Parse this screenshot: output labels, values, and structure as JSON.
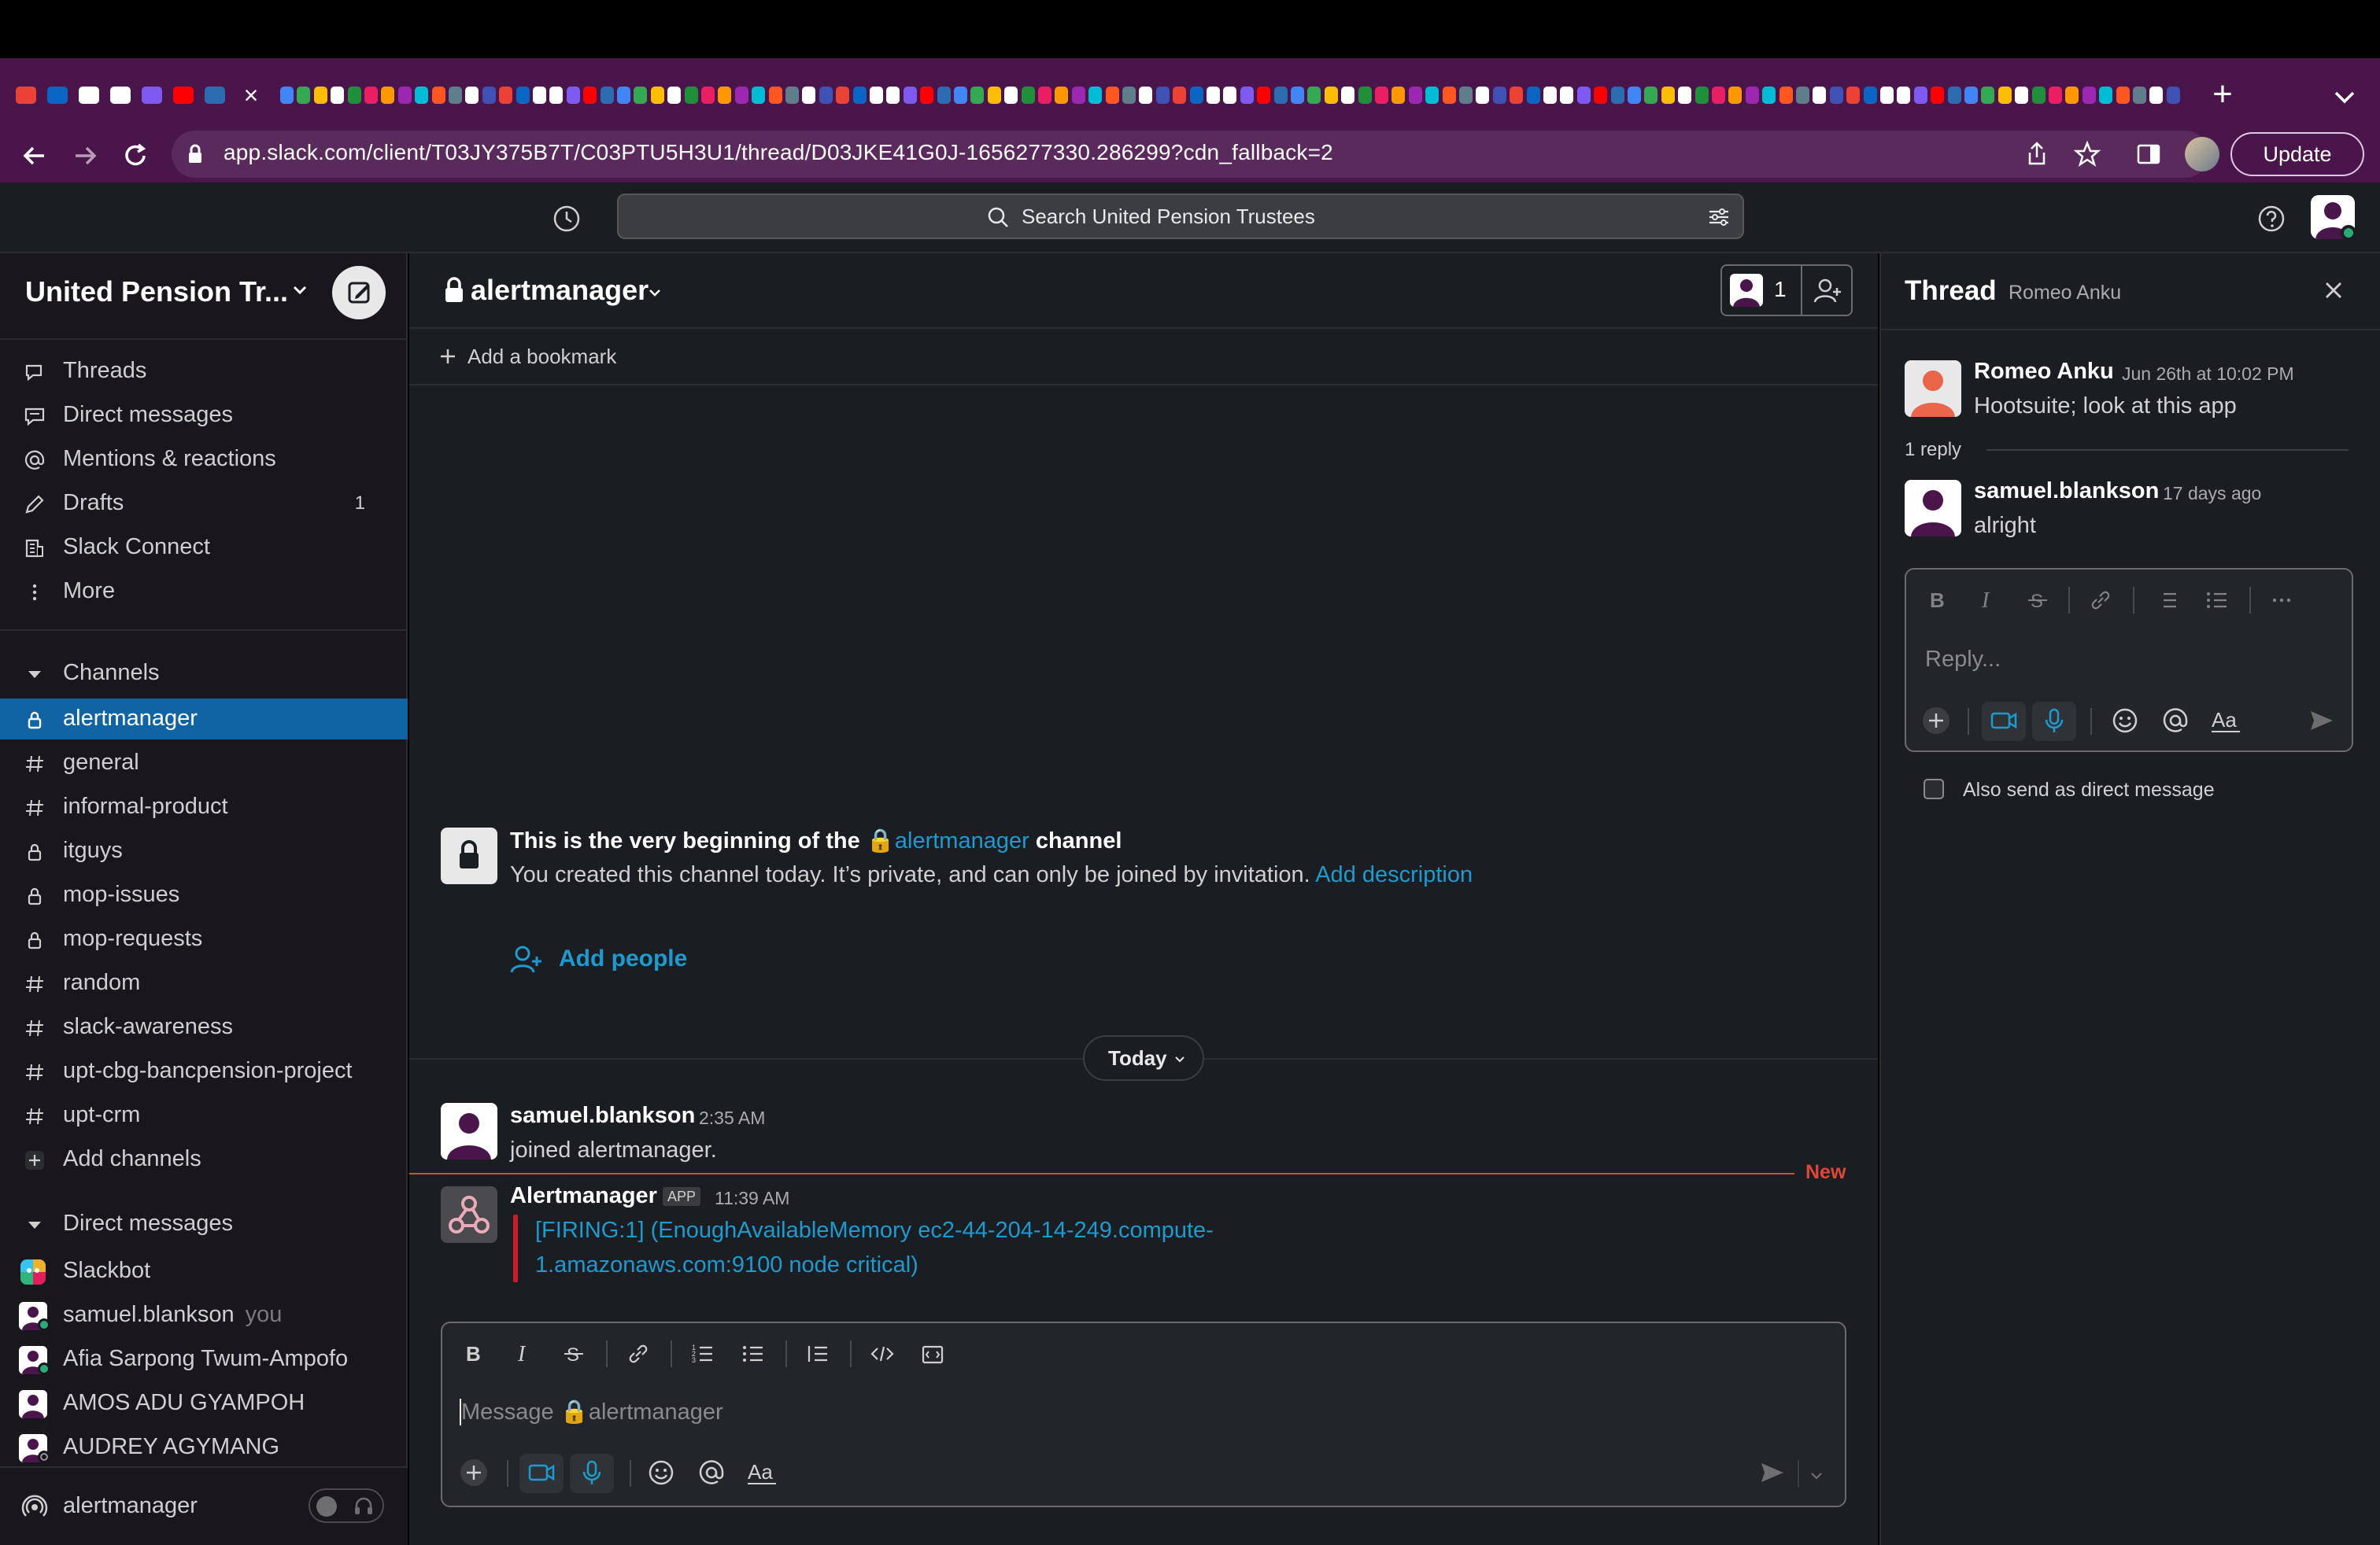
{
  "browser": {
    "url": "app.slack.com/client/T03JY375B7T/C03PTU5H3U1/thread/D03JKE41G0J-1656277330.286299?cdn_fallback=2",
    "update_label": "Update"
  },
  "topbar": {
    "search_placeholder": "Search United Pension Trustees"
  },
  "sidebar": {
    "workspace": "United Pension Tr...",
    "nav": [
      {
        "label": "Threads",
        "icon": "threads-icon"
      },
      {
        "label": "Direct messages",
        "icon": "direct-messages-icon"
      },
      {
        "label": "Mentions & reactions",
        "icon": "mentions-icon"
      },
      {
        "label": "Drafts",
        "icon": "drafts-icon",
        "count": "1"
      },
      {
        "label": "Slack Connect",
        "icon": "slack-connect-icon"
      },
      {
        "label": "More",
        "icon": "more-icon"
      }
    ],
    "channels_header": "Channels",
    "channels": [
      {
        "label": "alertmanager",
        "private": true,
        "active": true
      },
      {
        "label": "general",
        "private": false
      },
      {
        "label": "informal-product",
        "private": false
      },
      {
        "label": "itguys",
        "private": true
      },
      {
        "label": "mop-issues",
        "private": true
      },
      {
        "label": "mop-requests",
        "private": true
      },
      {
        "label": "random",
        "private": false
      },
      {
        "label": "slack-awareness",
        "private": false
      },
      {
        "label": "upt-cbg-bancpension-project",
        "private": false
      },
      {
        "label": "upt-crm",
        "private": false
      }
    ],
    "add_channels": "Add channels",
    "dm_header": "Direct messages",
    "dms": [
      {
        "label": "Slackbot",
        "suffix": ""
      },
      {
        "label": "samuel.blankson",
        "suffix": "you"
      },
      {
        "label": "Afia Sarpong Twum-Ampofo",
        "suffix": ""
      },
      {
        "label": "AMOS ADU GYAMPOH",
        "suffix": ""
      },
      {
        "label": "AUDREY AGYMANG",
        "suffix": ""
      }
    ],
    "huddle_label": "alertmanager"
  },
  "channel": {
    "name": "alertmanager",
    "member_count": "1",
    "add_bookmark": "Add a bookmark",
    "intro_title_prefix": "This is the very beginning of the",
    "intro_channel": "alertmanager",
    "intro_title_suffix": "channel",
    "intro_sub": "You created this channel today. It’s private, and can only be joined by invitation.",
    "intro_add_description": "Add description",
    "add_people": "Add people",
    "day_divider": "Today",
    "new_label": "New",
    "messages": [
      {
        "author": "samuel.blankson",
        "time": "2:35 AM",
        "text": "joined alertmanager."
      },
      {
        "author": "Alertmanager",
        "badge": "APP",
        "time": "11:39 AM",
        "line1": "[FIRING:1]  (EnoughAvailableMemory ec2-44-204-14-249.compute-",
        "line2": "1.amazonaws.com:9100 node critical)"
      }
    ],
    "composer_placeholder": "Message 🔒alertmanager"
  },
  "thread": {
    "title": "Thread",
    "subtitle": "Romeo Anku",
    "parent": {
      "author": "Romeo Anku",
      "time": "Jun 26th at 10:02 PM",
      "text": "Hootsuite; look at this app"
    },
    "reply_count": "1 reply",
    "reply": {
      "author": "samuel.blankson",
      "time": "17 days ago",
      "text": "alright"
    },
    "composer_placeholder": "Reply...",
    "also_send": "Also send as direct message"
  },
  "colors": {
    "aubergine": "#4a154b",
    "sidebar": "#19171d",
    "active": "#1164a3",
    "link": "#1d9bd1",
    "new_line": "#e0473b",
    "alert_bar": "#c91e2a"
  }
}
